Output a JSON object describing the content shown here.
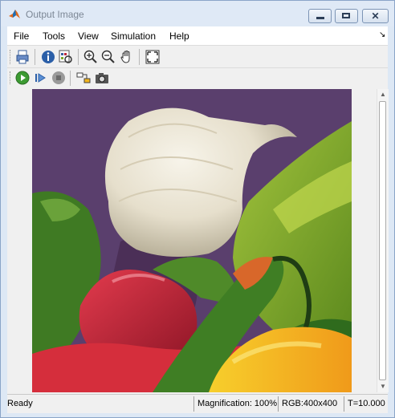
{
  "window": {
    "title": "Output Image",
    "app_icon": "matlab-icon",
    "buttons": [
      "minimize-icon",
      "maximize-icon",
      "close-icon"
    ]
  },
  "menu": {
    "items": [
      "File",
      "Tools",
      "View",
      "Simulation",
      "Help"
    ],
    "dock_icon": "dock-arrow-icon"
  },
  "toolbar1": {
    "icons": [
      "print-icon",
      "info-icon",
      "pixel-region-icon",
      "zoom-in-icon",
      "zoom-out-icon",
      "pan-hand-icon",
      "fit-to-window-icon"
    ]
  },
  "toolbar2": {
    "icons": [
      "run-icon",
      "step-forward-icon",
      "stop-icon",
      "highlight-block-icon",
      "snapshot-icon"
    ]
  },
  "image": {
    "subject": "peppers",
    "colors": {
      "background": "#5a3f6d",
      "onion": "#e8e2d2",
      "green_pepper": "#7ea92a",
      "red_pepper": "#c0283b",
      "yellow_pepper": "#f2b51e",
      "orange_chili": "#d8672a"
    }
  },
  "scrollbar": {
    "up_icon": "scroll-up-icon",
    "down_icon": "scroll-down-icon"
  },
  "status": {
    "state": "Ready",
    "magnification": "Magnification: 100%",
    "dimensions": "RGB:400x400",
    "time": "T=10.000"
  }
}
